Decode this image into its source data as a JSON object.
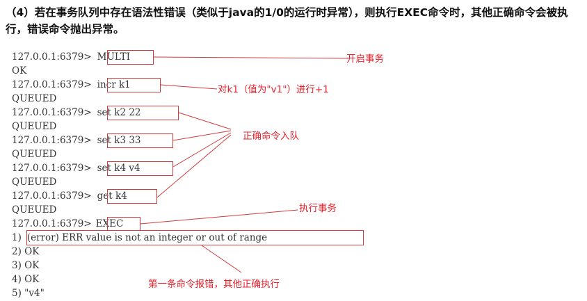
{
  "heading": "（4）若在事务队列中存在语法性错误（类似于java的1/0的运行时异常），则执行EXEC命令时，其他正确命令会被执行，错误命令抛出异常。",
  "terminal": {
    "lines": [
      {
        "prompt": "127.0.0.1:6379>",
        "cmd": "MULTI"
      },
      {
        "output": "OK"
      },
      {
        "prompt": "127.0.0.1:6379>",
        "cmd": "incr k1"
      },
      {
        "output": "QUEUED"
      },
      {
        "prompt": "127.0.0.1:6379>",
        "cmd": "set k2 22"
      },
      {
        "output": "QUEUED"
      },
      {
        "prompt": "127.0.0.1:6379>",
        "cmd": "set k3 33"
      },
      {
        "output": "QUEUED"
      },
      {
        "prompt": "127.0.0.1:6379>",
        "cmd": "set k4 v4"
      },
      {
        "output": "QUEUED"
      },
      {
        "prompt": "127.0.0.1:6379>",
        "cmd": "get k4"
      },
      {
        "output": "QUEUED"
      },
      {
        "prompt": "127.0.0.1:6379>",
        "cmd": "EXEC"
      },
      {
        "idx": "1)",
        "result": "(error) ERR value is not an integer or out of range"
      },
      {
        "output": "2) OK"
      },
      {
        "output": "3) OK"
      },
      {
        "output": "4) OK"
      },
      {
        "output": "5) \"v4\""
      }
    ]
  },
  "annotations": {
    "start_tx": "开启事务",
    "incr_note": "对k1（值为\"v1\"）进行+1",
    "queued_ok": "正确命令入队",
    "exec_tx": "执行事务",
    "first_err": "第一条命令报错，其他正确执行"
  },
  "colors": {
    "annotation": "#e8202a",
    "box": "#d43a3a",
    "text": "#333333"
  }
}
